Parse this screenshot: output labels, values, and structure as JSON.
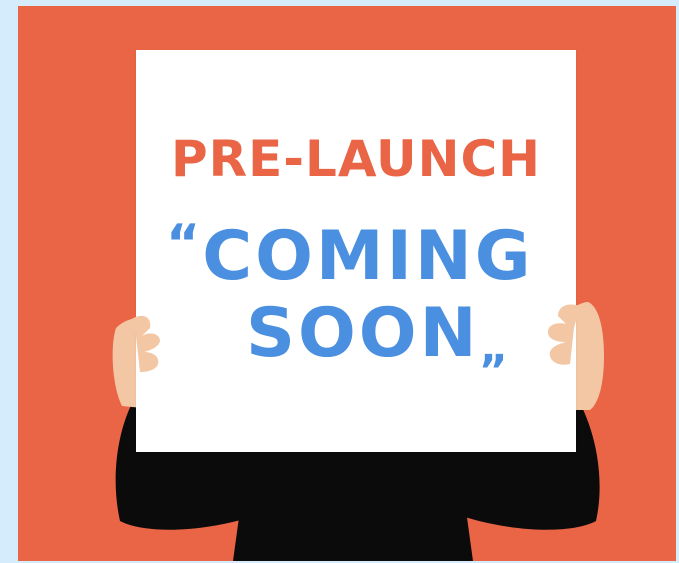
{
  "sign": {
    "headline": "PRE-LAUNCH",
    "line1": "COMING",
    "line2": "SOON",
    "open_quote": "“",
    "close_quote": "„"
  },
  "colors": {
    "background": "#e96545",
    "outer_frame": "#d4ecfb",
    "sign": "#ffffff",
    "headline": "#e96545",
    "body_text": "#4a8fe0",
    "clothing": "#0b0b0b",
    "skin": "#f3c7a4"
  }
}
